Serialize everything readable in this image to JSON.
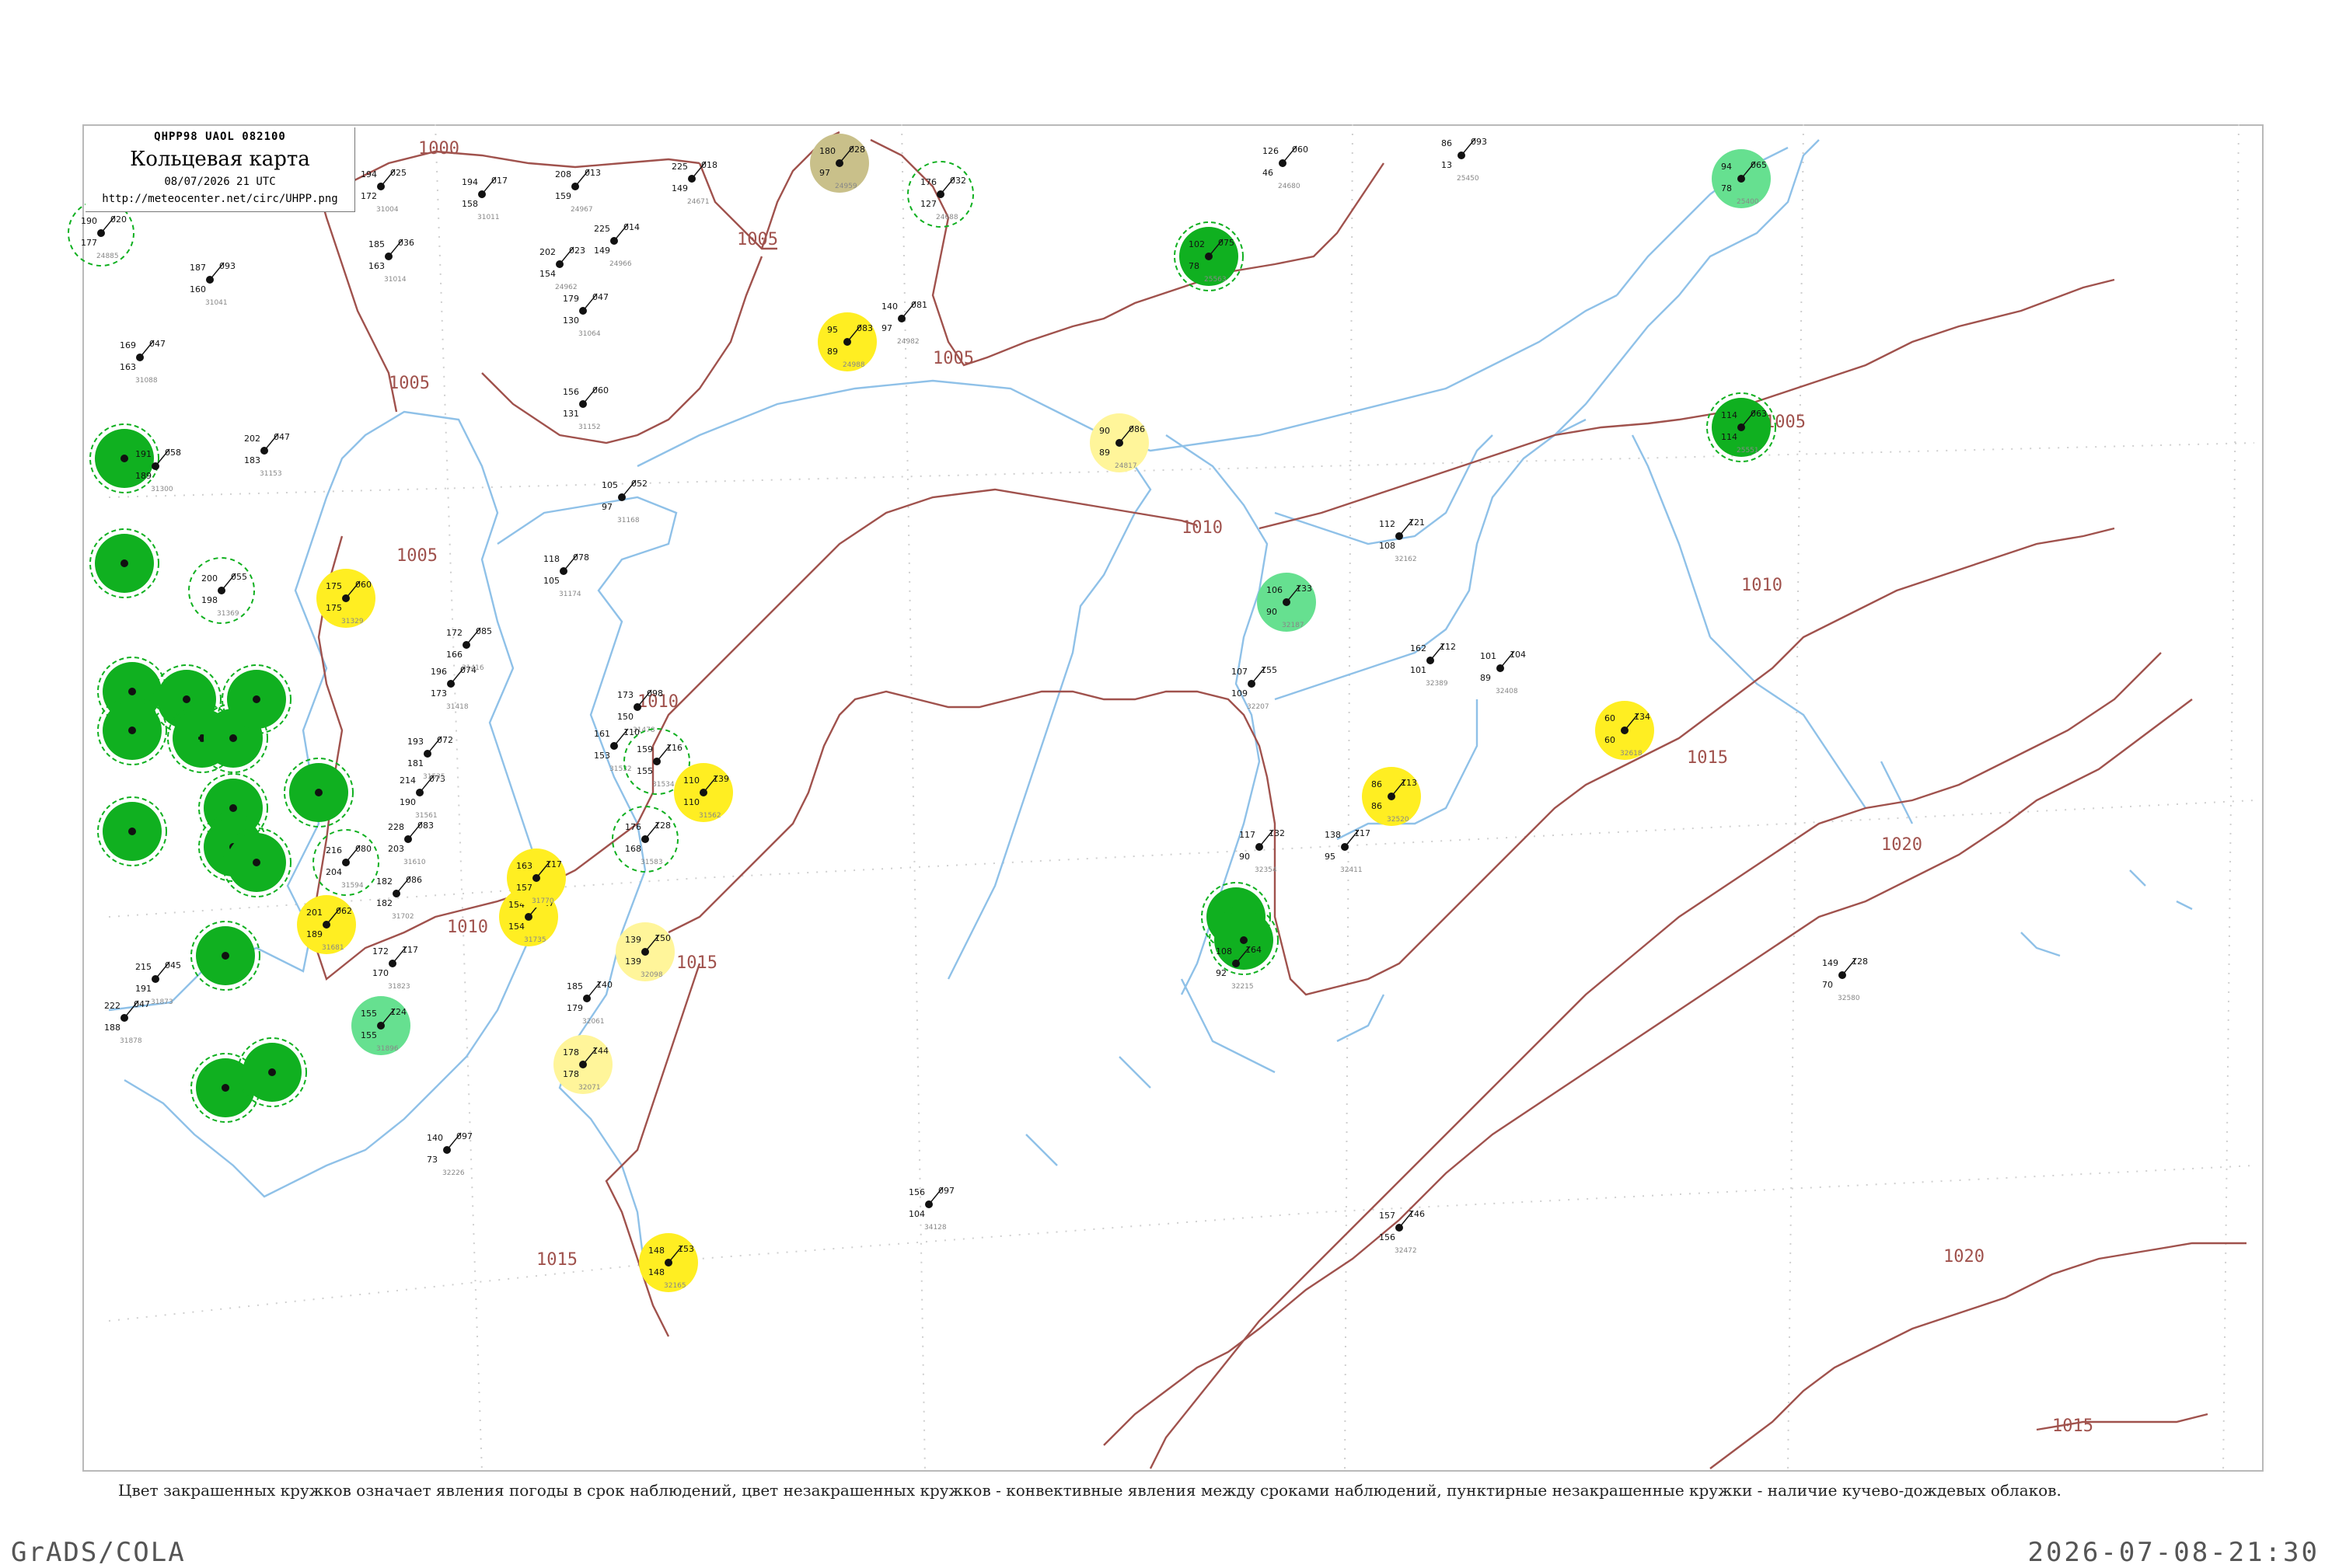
{
  "header": {
    "code_line": "QHPP98  UAOL  082100",
    "title": "Кольцевая карта",
    "datetime": "08/07/2026 21 UTC",
    "url": "http://meteocenter.net/circ/UHPP.png"
  },
  "caption": "Цвет закрашенных кружков означает явления погоды в срок наблюдений, цвет незакрашенных кружков - конвективные явления между сроками наблюдений, пунктирные незакрашенные кружки - наличие кучево-дождевых облаков.",
  "footer": {
    "left": "GrADS/COLA",
    "right": "2026-07-08-21:30"
  },
  "colors": {
    "isobar": "#a0524d",
    "coast": "#8fc1e8",
    "frame": "#b9b9b9",
    "green_dark": "#10b020",
    "green_light": "#66e090",
    "yellow": "#ffee22",
    "yellow_light": "#fff59a",
    "olive": "#c9c08a"
  },
  "isobars": [
    {
      "label": "1000"
    },
    {
      "label": "1005"
    },
    {
      "label": "1005"
    },
    {
      "label": "1005"
    },
    {
      "label": "1005"
    },
    {
      "label": "1005"
    },
    {
      "label": "1010"
    },
    {
      "label": "1010"
    },
    {
      "label": "1010"
    },
    {
      "label": "1010"
    },
    {
      "label": "1015"
    },
    {
      "label": "1015"
    },
    {
      "label": "1015"
    },
    {
      "label": "1015"
    },
    {
      "label": "1020"
    },
    {
      "label": "1020"
    },
    {
      "label": "1015"
    }
  ],
  "stations": [
    {
      "id": "24885",
      "a": "190",
      "b": "020",
      "c": "177"
    },
    {
      "id": "31004",
      "a": "194",
      "b": "025",
      "c": "172"
    },
    {
      "id": "31011",
      "a": "194",
      "b": "017",
      "c": "158"
    },
    {
      "id": "24967",
      "a": "208",
      "b": "013",
      "c": "159"
    },
    {
      "id": "24962",
      "a": "202",
      "b": "023",
      "c": "154"
    },
    {
      "id": "24966",
      "a": "225",
      "b": "014",
      "c": "149"
    },
    {
      "id": "24671",
      "a": "225",
      "b": "018",
      "c": "149"
    },
    {
      "id": "31014",
      "a": "185",
      "b": "036",
      "c": "163"
    },
    {
      "id": "31041",
      "a": "187",
      "b": "093",
      "c": "160"
    },
    {
      "id": "24959",
      "a": "180",
      "b": "028",
      "c": "97"
    },
    {
      "id": "24688",
      "a": "176",
      "b": "032",
      "c": "127"
    },
    {
      "id": "31064",
      "a": "179",
      "b": "047",
      "c": "130"
    },
    {
      "id": "24982",
      "a": "140",
      "b": "081",
      "c": "97"
    },
    {
      "id": "24988",
      "a": "95",
      "b": "083",
      "c": "89"
    },
    {
      "id": "31152",
      "a": "156",
      "b": "060",
      "c": "131"
    },
    {
      "id": "31168",
      "a": "105",
      "b": "052",
      "c": "97"
    },
    {
      "id": "31088",
      "a": "169",
      "b": "047",
      "c": "163"
    },
    {
      "id": "31153",
      "a": "202",
      "b": "047",
      "c": "183"
    },
    {
      "id": "31300",
      "a": "191",
      "b": "058",
      "c": "189"
    },
    {
      "id": "31174",
      "a": "118",
      "b": "078",
      "c": "105"
    },
    {
      "id": "31329",
      "a": "175",
      "b": "060",
      "c": "175"
    },
    {
      "id": "31369",
      "a": "200",
      "b": "055",
      "c": "198"
    },
    {
      "id": "31418",
      "a": "196",
      "b": "074",
      "c": "173"
    },
    {
      "id": "31416",
      "a": "172",
      "b": "085",
      "c": "166"
    },
    {
      "id": "31478",
      "a": "173",
      "b": "098",
      "c": "150"
    },
    {
      "id": "31532",
      "a": "161",
      "b": "110",
      "c": "153"
    },
    {
      "id": "31534",
      "a": "159",
      "b": "116",
      "c": "155"
    },
    {
      "id": "31562",
      "a": "110",
      "b": "139",
      "c": "110"
    },
    {
      "id": "31583",
      "a": "176",
      "b": "128",
      "c": "168"
    },
    {
      "id": "31561",
      "a": "214",
      "b": "073",
      "c": "190"
    },
    {
      "id": "31535",
      "a": "193",
      "b": "072",
      "c": "181"
    },
    {
      "id": "31594",
      "a": "216",
      "b": "080",
      "c": "204"
    },
    {
      "id": "31610",
      "a": "228",
      "b": "083",
      "c": "203"
    },
    {
      "id": "31702",
      "a": "182",
      "b": "086",
      "c": "182"
    },
    {
      "id": "31735",
      "a": "154",
      "b": "117",
      "c": "154"
    },
    {
      "id": "31681",
      "a": "201",
      "b": "062",
      "c": "189"
    },
    {
      "id": "31770",
      "a": "163",
      "b": "117",
      "c": "157"
    },
    {
      "id": "31823",
      "a": "172",
      "b": "117",
      "c": "170"
    },
    {
      "id": "31873",
      "a": "215",
      "b": "045",
      "c": "191"
    },
    {
      "id": "31878",
      "a": "222",
      "b": "047",
      "c": "188"
    },
    {
      "id": "31896",
      "a": "155",
      "b": "124",
      "c": "155"
    },
    {
      "id": "32098",
      "a": "139",
      "b": "150",
      "c": "139"
    },
    {
      "id": "32061",
      "a": "185",
      "b": "140",
      "c": "179"
    },
    {
      "id": "32071",
      "a": "178",
      "b": "144",
      "c": "178"
    },
    {
      "id": "32165",
      "a": "148",
      "b": "153",
      "c": "148"
    },
    {
      "id": "32226",
      "a": "140",
      "b": "097",
      "c": "73"
    },
    {
      "id": "34128",
      "a": "156",
      "b": "097",
      "c": "104"
    },
    {
      "id": "24680",
      "a": "126",
      "b": "060",
      "c": "46"
    },
    {
      "id": "25400",
      "a": "94",
      "b": "065",
      "c": "78"
    },
    {
      "id": "25450",
      "a": "86",
      "b": "093",
      "c": "13"
    },
    {
      "id": "24817",
      "a": "90",
      "b": "086",
      "c": "89"
    },
    {
      "id": "32162",
      "a": "112",
      "b": "121",
      "c": "108"
    },
    {
      "id": "32187",
      "a": "106",
      "b": "133",
      "c": "90"
    },
    {
      "id": "32389",
      "a": "162",
      "b": "112",
      "c": "101"
    },
    {
      "id": "32408",
      "a": "101",
      "b": "104",
      "c": "89"
    },
    {
      "id": "32207",
      "a": "107",
      "b": "155",
      "c": "109"
    },
    {
      "id": "32354",
      "a": "117",
      "b": "132",
      "c": "90"
    },
    {
      "id": "32411",
      "a": "138",
      "b": "117",
      "c": "95"
    },
    {
      "id": "32520",
      "a": "86",
      "b": "113",
      "c": "86"
    },
    {
      "id": "32618",
      "a": "60",
      "b": "134",
      "c": "60"
    },
    {
      "id": "32215",
      "a": "108",
      "b": "164",
      "c": "92"
    },
    {
      "id": "32580",
      "a": "149",
      "b": "128",
      "c": "70"
    },
    {
      "id": "32472",
      "a": "157",
      "b": "146",
      "c": "156"
    },
    {
      "id": "25551",
      "a": "114",
      "b": "063",
      "c": "114"
    },
    {
      "id": "25563",
      "a": "102",
      "b": "075",
      "c": "78"
    }
  ]
}
